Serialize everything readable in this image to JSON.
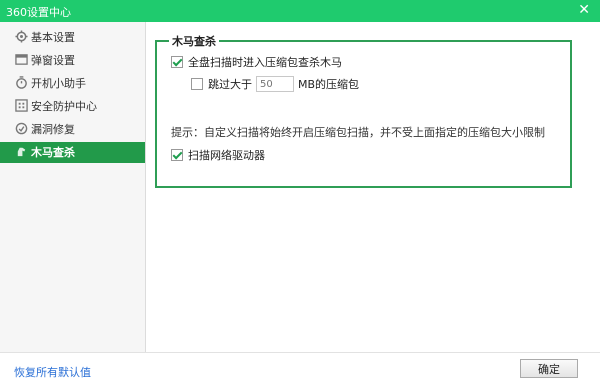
{
  "window": {
    "title": "360设置中心",
    "close_glyph": "✕"
  },
  "sidebar": {
    "items": [
      {
        "label": "基本设置",
        "icon": "gear-icon"
      },
      {
        "label": "弹窗设置",
        "icon": "popup-window-icon"
      },
      {
        "label": "开机小助手",
        "icon": "startup-timer-icon"
      },
      {
        "label": "安全防护中心",
        "icon": "shield-grid-icon"
      },
      {
        "label": "漏洞修复",
        "icon": "repair-icon"
      },
      {
        "label": "木马查杀",
        "icon": "trojan-horse-icon",
        "active": true
      }
    ]
  },
  "panel": {
    "group_title": "木马查杀",
    "scan_archives": {
      "label": "全盘扫描时进入压缩包查杀木马",
      "checked": true
    },
    "skip_larger": {
      "label_before": "跳过大于",
      "value": "",
      "placeholder": "50",
      "label_after": "MB的压缩包",
      "checked": false
    },
    "hint": "提示：自定义扫描将始终开启压缩包扫描，并不受上面指定的压缩包大小限制",
    "scan_network": {
      "label": "扫描网络驱动器",
      "checked": true
    }
  },
  "footer": {
    "restore_label": "恢复所有默认值",
    "ok_label": "确定"
  },
  "colors": {
    "titlebar": "#1fcb6e",
    "active_item": "#229a4a",
    "group_border": "#2f9e56",
    "link": "#2a6fd6"
  }
}
